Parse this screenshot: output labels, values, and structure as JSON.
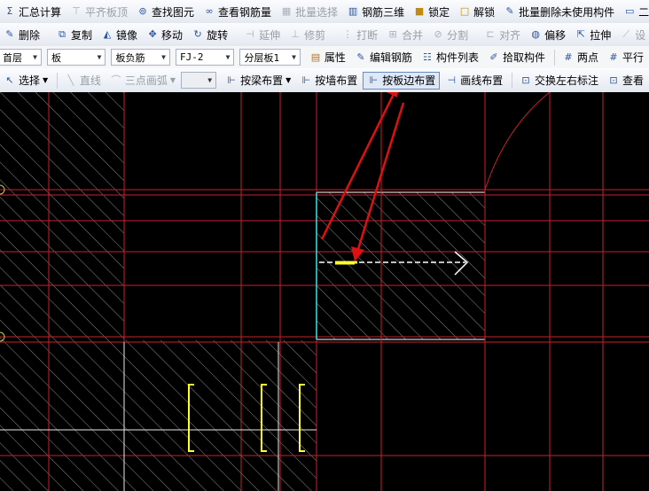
{
  "toolbar_main": {
    "items": [
      {
        "label": "汇总计算",
        "icon": "sum-icon",
        "enabled": true
      },
      {
        "label": "平齐板顶",
        "icon": "align-top-icon",
        "enabled": false
      },
      {
        "label": "查找图元",
        "icon": "binoculars-icon",
        "enabled": true
      },
      {
        "label": "查看钢筋量",
        "icon": "glasses-icon",
        "enabled": true
      },
      {
        "label": "批量选择",
        "icon": "batch-select-icon",
        "enabled": false
      },
      {
        "label": "钢筋三维",
        "icon": "rebar-3d-icon",
        "enabled": true
      },
      {
        "label": "锁定",
        "icon": "lock-icon",
        "enabled": true
      },
      {
        "label": "解锁",
        "icon": "unlock-icon",
        "enabled": true
      },
      {
        "label": "批量删除未使用构件",
        "icon": "batch-delete-icon",
        "enabled": true
      },
      {
        "label": "二维",
        "icon": "view-2d-icon",
        "enabled": true
      }
    ]
  },
  "toolbar_edit": {
    "items": [
      {
        "label": "删除",
        "icon": "delete-icon",
        "enabled": true
      },
      {
        "label": "复制",
        "icon": "copy-icon",
        "enabled": true
      },
      {
        "label": "镜像",
        "icon": "mirror-icon",
        "enabled": true
      },
      {
        "label": "移动",
        "icon": "move-icon",
        "enabled": true
      },
      {
        "label": "旋转",
        "icon": "rotate-icon",
        "enabled": true
      },
      {
        "label": "延伸",
        "icon": "extend-icon",
        "enabled": false
      },
      {
        "label": "修剪",
        "icon": "trim-icon",
        "enabled": false
      },
      {
        "label": "打断",
        "icon": "break-icon",
        "enabled": false
      },
      {
        "label": "合并",
        "icon": "merge-icon",
        "enabled": false
      },
      {
        "label": "分割",
        "icon": "split-icon",
        "enabled": false
      },
      {
        "label": "对齐",
        "icon": "align-icon",
        "enabled": false
      },
      {
        "label": "偏移",
        "icon": "offset-icon",
        "enabled": true
      },
      {
        "label": "拉伸",
        "icon": "stretch-icon",
        "enabled": true
      },
      {
        "label": "设",
        "icon": "settings-icon",
        "enabled": false
      }
    ]
  },
  "selectors": {
    "floor": "首层",
    "category": "板",
    "subcategory": "板负筋",
    "component": "FJ-2",
    "layer": "分层板1"
  },
  "toolbar_props": {
    "items": [
      {
        "label": "属性",
        "icon": "properties-icon"
      },
      {
        "label": "编辑钢筋",
        "icon": "edit-rebar-icon"
      },
      {
        "label": "构件列表",
        "icon": "component-list-icon"
      },
      {
        "label": "拾取构件",
        "icon": "pick-icon"
      },
      {
        "label": "两点",
        "icon": "two-point-icon"
      },
      {
        "label": "平行",
        "icon": "parallel-icon"
      }
    ]
  },
  "toolbar_draw": {
    "select": "选择",
    "line": "直线",
    "arc": "三点画弧",
    "combo_value": "",
    "by_beam": "按梁布置",
    "by_wall": "按墙布置",
    "by_slab_edge": "按板边布置",
    "draw_line": "画线布置",
    "swap_label": "交换左右标注",
    "view": "查看"
  },
  "colors": {
    "canvas_bg": "#000000",
    "grid_line": "#c8202c",
    "hatch": "#8a8a8a",
    "slab_border": "#ffffff",
    "rebar": "#ffff33",
    "selected_edge": "#40e0e0",
    "annotation_arrow": "#e01010"
  }
}
